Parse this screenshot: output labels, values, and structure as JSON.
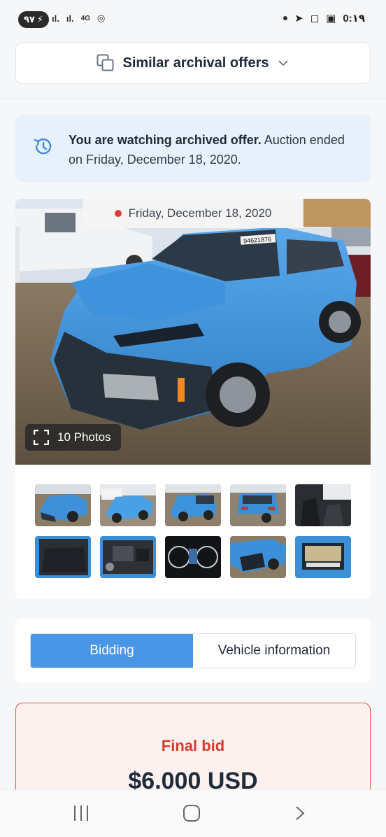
{
  "status_bar": {
    "battery": "۹۷",
    "network": "4G",
    "time": "0:۱۹"
  },
  "similar": {
    "label": "Similar archival offers"
  },
  "banner": {
    "bold": "You are watching archived offer.",
    "rest": " Auction ended on Friday, December 18, 2020."
  },
  "gallery": {
    "date": "Friday, December 18, 2020",
    "photos_label": "10 Photos",
    "plate_text": "94621876",
    "thumbnails": [
      {
        "name": "front-damage"
      },
      {
        "name": "front-left"
      },
      {
        "name": "rear-left"
      },
      {
        "name": "rear"
      },
      {
        "name": "front-seats"
      },
      {
        "name": "rear-seats"
      },
      {
        "name": "engine"
      },
      {
        "name": "instrument-cluster"
      },
      {
        "name": "front-bumper-closeup"
      },
      {
        "name": "label-sticker"
      }
    ]
  },
  "tabs": {
    "bidding": "Bidding",
    "vehicle_info": "Vehicle information",
    "active": "bidding"
  },
  "final_bid": {
    "label": "Final bid",
    "value": "$6.000 USD"
  },
  "colors": {
    "accent": "#4a96e6",
    "bid_red": "#d63c2f",
    "car_blue": "#3a8fd6"
  }
}
